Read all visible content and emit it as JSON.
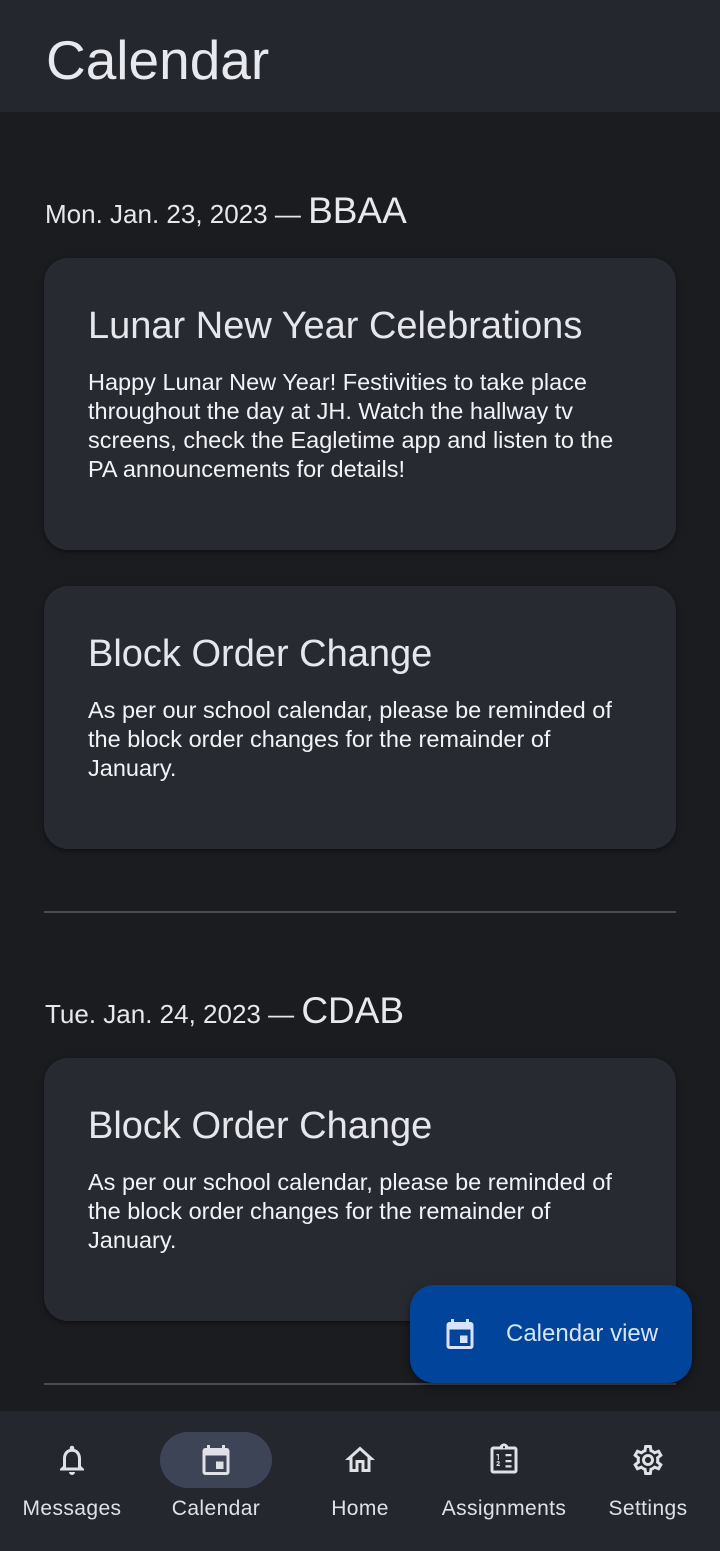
{
  "app_bar": {
    "title": "Calendar"
  },
  "days": [
    {
      "date": "Mon. Jan. 23, 2023",
      "separator": " — ",
      "block_order": "BBAA",
      "events": [
        {
          "title": "Lunar New Year Celebrations",
          "body": "Happy Lunar New Year! Festivities to take place throughout the day at JH. Watch the hallway tv screens, check the Eagletime app and listen to the PA announcements for details!"
        },
        {
          "title": "Block Order Change",
          "body": "As per our school calendar, please be reminded of the block order changes for the remainder of January."
        }
      ]
    },
    {
      "date": "Tue. Jan. 24, 2023",
      "separator": " — ",
      "block_order": "CDAB",
      "events": [
        {
          "title": "Block Order Change",
          "body": "As per our school calendar, please be reminded of the block order changes for the remainder of January."
        }
      ]
    }
  ],
  "fab": {
    "label": "Calendar view",
    "icon": "calendar-icon"
  },
  "bottom_nav": {
    "items": [
      {
        "label": "Messages",
        "icon": "bell-icon",
        "active": false
      },
      {
        "label": "Calendar",
        "icon": "calendar-icon",
        "active": true
      },
      {
        "label": "Home",
        "icon": "home-icon",
        "active": false
      },
      {
        "label": "Assignments",
        "icon": "assignment-icon",
        "active": false
      },
      {
        "label": "Settings",
        "icon": "gear-icon",
        "active": false
      }
    ]
  },
  "colors": {
    "background": "#1b1c20",
    "surface": "#24272d",
    "card": "#272a31",
    "fab": "#00459b",
    "nav_active_pill": "#3c4456",
    "divider": "#4a4c52"
  }
}
